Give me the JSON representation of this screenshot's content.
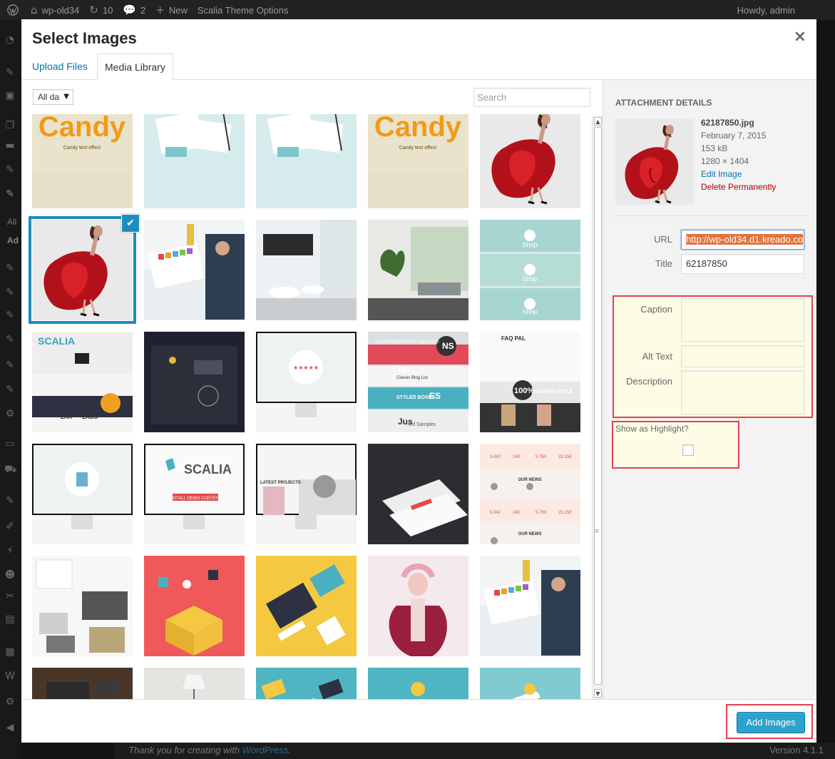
{
  "admin_bar": {
    "site_name": "wp-old34",
    "updates_count": "10",
    "comments_count": "2",
    "new_label": "New",
    "theme_options": "Scalia Theme Options",
    "greeting": "Howdy, admin"
  },
  "admin_menu": {
    "all_label": "All",
    "add_label": "Ad"
  },
  "footer": {
    "thanks": "Thank you for creating with",
    "link": "WordPress",
    "period": ".",
    "version": "Version 4.1.1"
  },
  "modal": {
    "title": "Select Images",
    "close": "×",
    "tabs": [
      {
        "label": "Upload Files",
        "active": false
      },
      {
        "label": "Media Library",
        "active": true
      }
    ],
    "filter": {
      "value": "All da",
      "arrow": "▼"
    },
    "search": {
      "placeholder": "Search"
    },
    "selected_check": "✔",
    "scroll_up": "▲",
    "scroll_down": "▼",
    "scroll_grip": "≡"
  },
  "tiles": [
    {
      "name": "candy-text-effect-1",
      "theme": "candy",
      "text": "Candy",
      "sub": "Candy text effect"
    },
    {
      "name": "stationery-mockup-1",
      "theme": "stationery"
    },
    {
      "name": "stationery-mockup-2",
      "theme": "stationery"
    },
    {
      "name": "candy-text-effect-2",
      "theme": "candy",
      "text": "Candy",
      "sub": "Candy text effect"
    },
    {
      "name": "red-dress-photo-crop",
      "theme": "reddress"
    },
    {
      "name": "red-dress-photo",
      "theme": "reddress",
      "selected": true
    },
    {
      "name": "color-swatch-tablet",
      "theme": "swatch"
    },
    {
      "name": "bathroom-interior",
      "theme": "bathroom"
    },
    {
      "name": "living-room-interior",
      "theme": "living"
    },
    {
      "name": "shop-screens",
      "theme": "shop",
      "labels": [
        "Shop",
        "Shop",
        "Shop"
      ]
    },
    {
      "name": "scalia-portfolio-screens",
      "theme": "scaliaports",
      "labels": [
        "SCALIA",
        "ZAR",
        "ZABO"
      ]
    },
    {
      "name": "dark-theme-screens",
      "theme": "dark"
    },
    {
      "name": "monitor-rating",
      "theme": "monitor",
      "labels": [
        "★★★★★"
      ]
    },
    {
      "name": "quickfinder-screens",
      "theme": "quickfinder",
      "labels": [
        "QUICKFINDER WITH SQUARED",
        "NS",
        "Clas",
        "Classic Blog List",
        "STYLED BOXES",
        "ES",
        "Jus",
        "red Samples"
      ]
    },
    {
      "name": "faq-masonry-screens",
      "theme": "faq",
      "labels": [
        "FAQ PAL",
        "100%",
        "ASONRY STYLE"
      ]
    },
    {
      "name": "monitor-document",
      "theme": "monitordoc"
    },
    {
      "name": "monitor-scalia-logo",
      "theme": "monitorscalia",
      "labels": [
        "SCALIA",
        "INSTALL DEMO CONTENT"
      ]
    },
    {
      "name": "monitor-latest-projects",
      "theme": "monitorprojects",
      "labels": [
        "LATEST PROJECTS"
      ]
    },
    {
      "name": "dark-perspective-screens",
      "theme": "perspective"
    },
    {
      "name": "our-news-screens",
      "theme": "news",
      "labels": [
        "OUR NEWS",
        "OUR NEWS",
        "3.042",
        "240",
        "5.760",
        "23.158",
        "5.042",
        "240",
        "5.760",
        "23.158"
      ]
    },
    {
      "name": "blog-grid-photos",
      "theme": "bloggrid"
    },
    {
      "name": "flat-gift-box",
      "theme": "giftbox"
    },
    {
      "name": "flat-desk-yellow",
      "theme": "flatdesk"
    },
    {
      "name": "pink-hair-model",
      "theme": "model"
    },
    {
      "name": "color-swatch-tablet-2",
      "theme": "swatch"
    },
    {
      "name": "wooden-desk-keyboard",
      "theme": "desk"
    },
    {
      "name": "lingerie-model-lamp",
      "theme": "lamp"
    },
    {
      "name": "flat-workspace-teal",
      "theme": "workspace"
    },
    {
      "name": "flat-laboratory",
      "theme": "lab"
    },
    {
      "name": "flat-mobile-ui",
      "theme": "mobile"
    }
  ],
  "details": {
    "heading": "ATTACHMENT DETAILS",
    "filename": "62187850.jpg",
    "date": "February 7, 2015",
    "size": "153 kB",
    "dimensions": "1280 × 1404",
    "edit_link": "Edit Image",
    "delete_link": "Delete Permanently",
    "url_label": "URL",
    "url_value": "http://wp-old34.d1.kreado.co",
    "title_label": "Title",
    "title_value": "62187850",
    "caption_label": "Caption",
    "caption_value": "",
    "alt_label": "Alt Text",
    "alt_value": "",
    "description_label": "Description",
    "description_value": "",
    "highlight_label": "Show as Highlight?",
    "highlight_checked": false
  },
  "toolbar": {
    "add_button": "Add Images"
  },
  "colors": {
    "accent": "#1e8cbe",
    "primary_button": "#2ea2cc",
    "link": "#0073aa",
    "delete": "#a00",
    "highlight_outline": "#e24050",
    "highlight_bg": "#fdfde6"
  }
}
